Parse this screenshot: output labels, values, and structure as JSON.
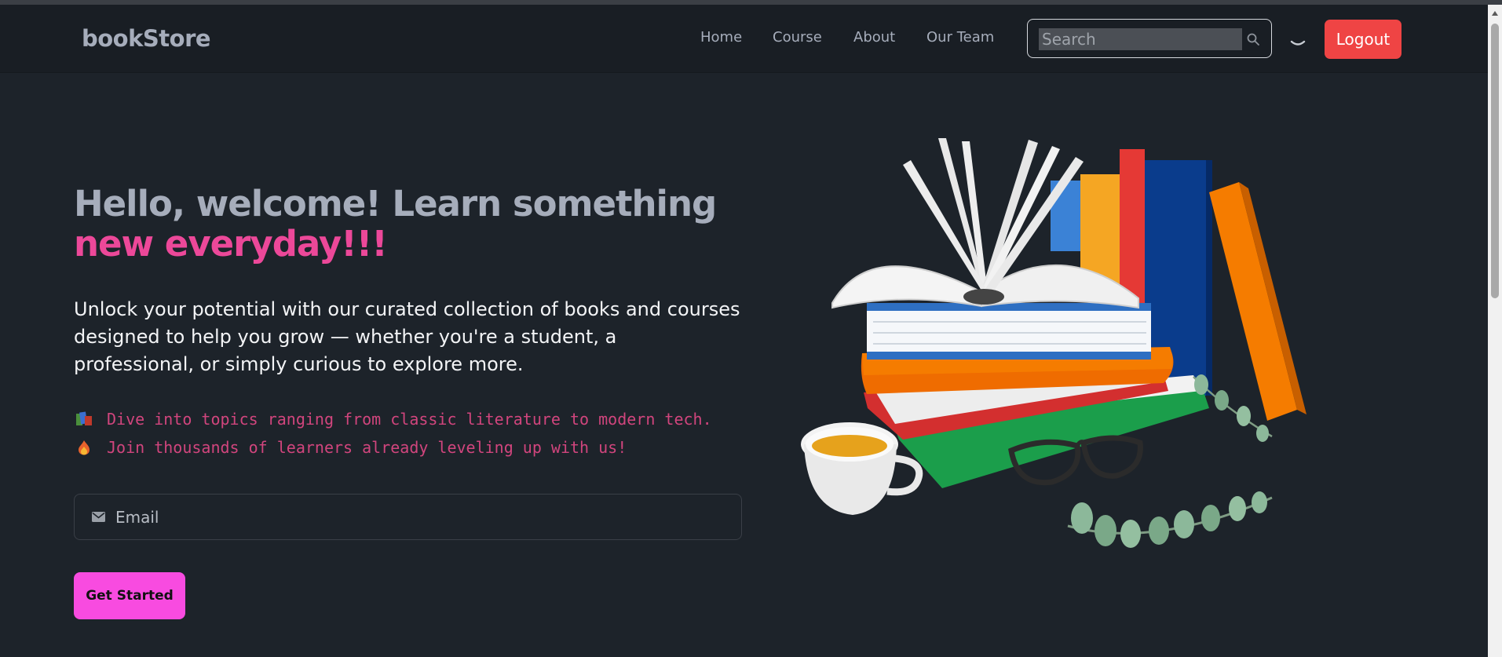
{
  "nav": {
    "brand": "bookStore",
    "links": [
      "Home",
      "Course",
      "About",
      "Our Team"
    ],
    "search_placeholder": "Search",
    "logout_label": "Logout"
  },
  "hero": {
    "title_line1": "Hello, welcome! Learn something",
    "title_line2": "new everyday!!!",
    "description": "Unlock your potential with our curated collection of books and courses designed to help you grow — whether you're a student, a professional, or simply curious to explore more.",
    "features": [
      {
        "icon": "books-icon",
        "text": "Dive into topics ranging from classic literature to modern tech."
      },
      {
        "icon": "fire-icon",
        "text": "Join thousands of learners already leveling up with us!"
      }
    ],
    "email_placeholder": "Email",
    "cta_label": "Get Started"
  },
  "colors": {
    "page_bg": "#1d232a",
    "navbar_bg": "#191e24",
    "accent_pink": "#ec4899",
    "cta_bg": "#f84be0",
    "logout_bg": "#ef4444",
    "muted_text": "#a6adbb",
    "feature_text": "#d1457d"
  }
}
